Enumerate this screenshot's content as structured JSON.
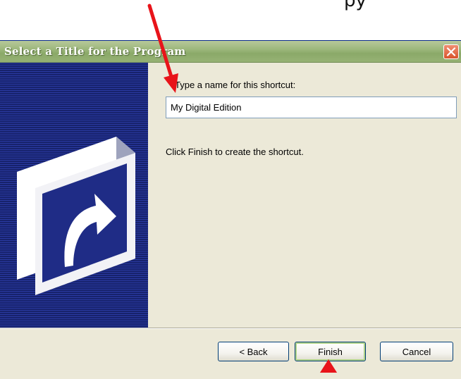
{
  "top_caption": "py",
  "dialog": {
    "title": "Select a Title for the Program",
    "prompt": "Type a name for this shortcut:",
    "shortcut_name": "My Digital Edition",
    "info": "Click Finish to create the shortcut.",
    "buttons": {
      "back": "< Back",
      "finish": "Finish",
      "cancel": "Cancel"
    }
  },
  "icons": {
    "close": "close-icon",
    "banner": "shortcut-arrow-icon"
  },
  "colors": {
    "annotation": "#e8141a",
    "titlebar": "#9db77c",
    "banner": "#1d2b82",
    "dialog_bg": "#ece9d8"
  }
}
